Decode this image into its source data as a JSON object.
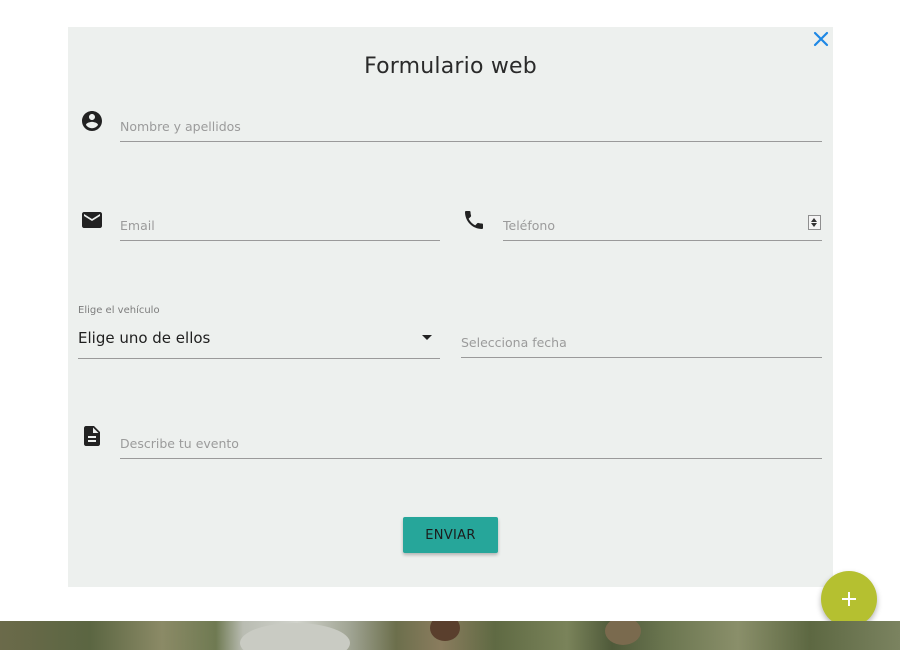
{
  "modal": {
    "title": "Formulario web",
    "close_icon": "close-icon"
  },
  "form": {
    "name_placeholder": "Nombre y apellidos",
    "email_placeholder": "Email",
    "phone_placeholder": "Teléfono",
    "vehicle_label": "Elige el vehículo",
    "vehicle_selected": "Elige uno de ellos",
    "date_placeholder": "Selecciona fecha",
    "event_placeholder": "Describe tu evento",
    "submit_label": "ENVIAR"
  },
  "icons": {
    "name": "account-circle-icon",
    "email": "envelope-icon",
    "phone": "phone-icon",
    "event": "document-icon",
    "fab": "plus-icon"
  },
  "colors": {
    "modal_bg": "#edf0ee",
    "close_accent": "#1e88e5",
    "submit_bg": "#26a69a",
    "fab_bg": "#b5c030"
  }
}
